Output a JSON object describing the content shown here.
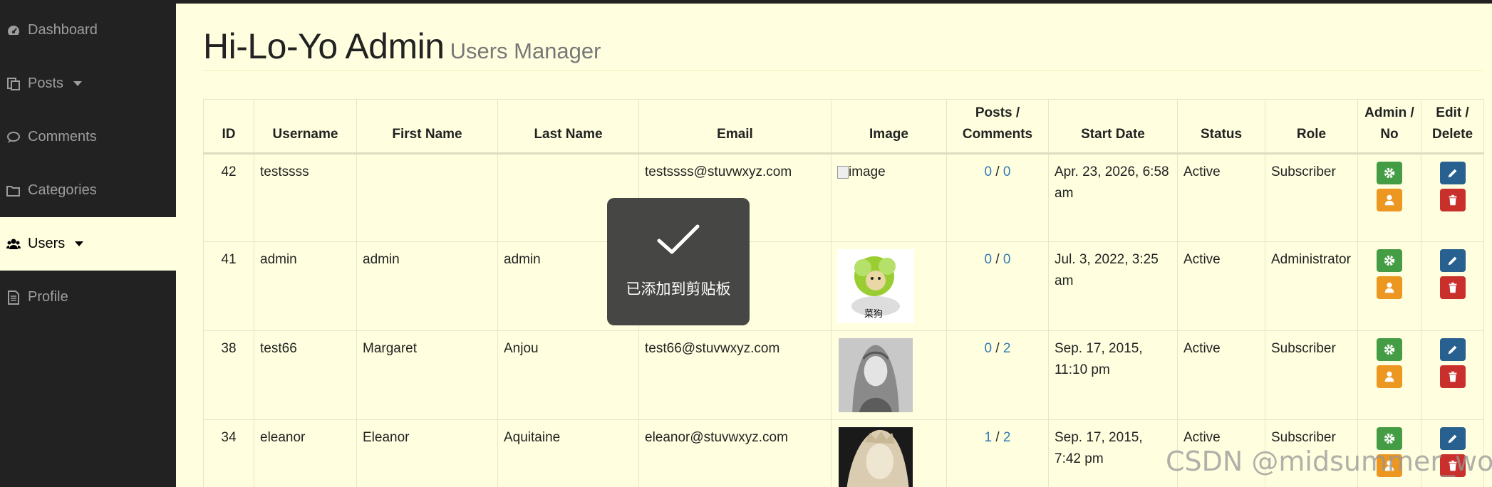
{
  "sidebar": {
    "items": [
      {
        "label": "Dashboard",
        "icon": "dashboard-icon",
        "has_caret": false
      },
      {
        "label": "Posts",
        "icon": "file-icon",
        "has_caret": true
      },
      {
        "label": "Comments",
        "icon": "comment-icon",
        "has_caret": false
      },
      {
        "label": "Categories",
        "icon": "folder-icon",
        "has_caret": false
      },
      {
        "label": "Users",
        "icon": "users-icon",
        "has_caret": true,
        "active": true
      },
      {
        "label": "Profile",
        "icon": "document-icon",
        "has_caret": false
      }
    ]
  },
  "header": {
    "title": "Hi-Lo-Yo Admin",
    "subtitle": "Users Manager"
  },
  "table": {
    "columns": {
      "id": "ID",
      "username": "Username",
      "first_name": "First Name",
      "last_name": "Last Name",
      "email": "Email",
      "image": "Image",
      "posts_comments_1": "Posts /",
      "posts_comments_2": "Comments",
      "start_date": "Start Date",
      "status": "Status",
      "role": "Role",
      "admin_no_1": "Admin /",
      "admin_no_2": "No",
      "edit_delete_1": "Edit /",
      "edit_delete_2": "Delete"
    },
    "rows": [
      {
        "id": "42",
        "username": "testssss",
        "first_name": "",
        "last_name": "",
        "email": "testssss@stuvwxyz.com",
        "image_alt": "image",
        "posts": "0",
        "sep": "/",
        "comments": "0",
        "start_date": "Apr. 23, 2026, 6:58 am",
        "status": "Active",
        "role": "Subscriber"
      },
      {
        "id": "41",
        "username": "admin",
        "first_name": "admin",
        "last_name": "admin",
        "email": "",
        "image_caption": "菜狗",
        "posts": "0",
        "sep": "/",
        "comments": "0",
        "start_date": "Jul. 3, 2022, 3:25 am",
        "status": "Active",
        "role": "Administrator"
      },
      {
        "id": "38",
        "username": "test66",
        "first_name": "Margaret",
        "last_name": "Anjou",
        "email": "test66@stuvwxyz.com",
        "posts": "0",
        "sep": "/",
        "comments": "2",
        "start_date": "Sep. 17, 2015, 11:10 pm",
        "status": "Active",
        "role": "Subscriber"
      },
      {
        "id": "34",
        "username": "eleanor",
        "first_name": "Eleanor",
        "last_name": "Aquitaine",
        "email": "eleanor@stuvwxyz.com",
        "posts": "1",
        "sep": "/",
        "comments": "2",
        "start_date": "Sep. 17, 2015, 7:42 pm",
        "status": "Active",
        "role": "Subscriber"
      }
    ]
  },
  "toast": {
    "message": "已添加到剪贴板"
  },
  "watermark": "CSDN @midsummer_woo",
  "colors": {
    "sidebar_bg": "#222222",
    "page_bg": "#ffffe0",
    "link_blue": "#337ab7",
    "btn_green": "#449d44",
    "btn_orange": "#ec971f",
    "btn_navy": "#286090",
    "btn_red": "#c9302c"
  }
}
